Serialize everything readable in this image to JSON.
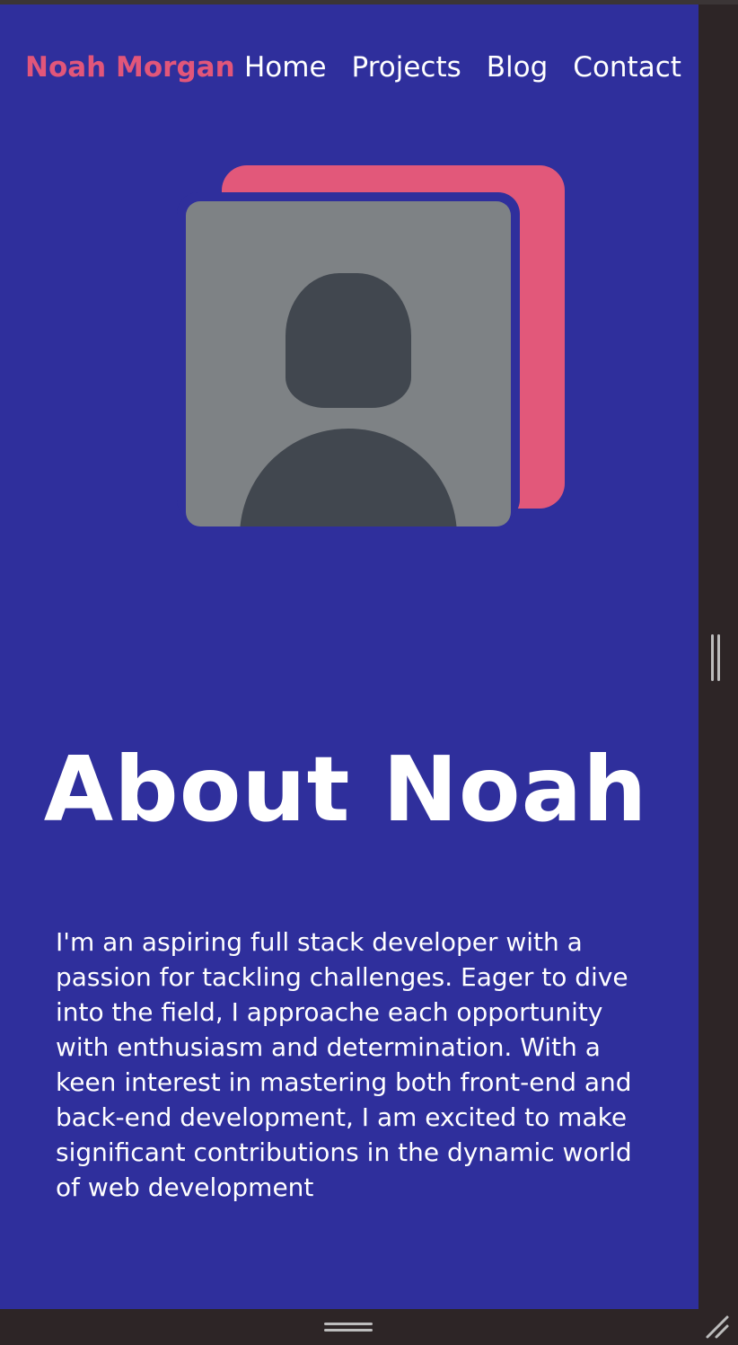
{
  "nav": {
    "brand": "Noah Morgan",
    "links": [
      "Home",
      "Projects",
      "Blog",
      "Contact"
    ]
  },
  "hero": {
    "avatar_icon": "user-avatar-placeholder-icon"
  },
  "about": {
    "title": "About Noah",
    "text": "I'm an aspiring full stack developer with a passion for tackling challenges. Eager to dive into the field, I approache each opportunity with enthusiasm and determination. With a keen interest in mastering both front-end and back-end development, I am excited to make significant contributions in the dynamic world of web development"
  },
  "colors": {
    "page_background": "#2f2f9c",
    "accent": "#e2567a",
    "text": "#ffffff",
    "avatar_background": "#7e8285",
    "avatar_figure": "#41474f",
    "window_chrome": "#2d2526"
  }
}
